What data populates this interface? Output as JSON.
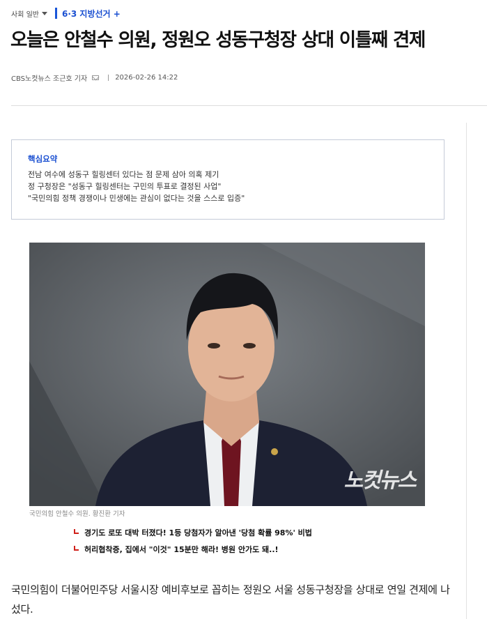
{
  "topbar": {
    "category": "사회 일반",
    "series": "6·3 지방선거 +"
  },
  "article": {
    "headline": "오늘은 안철수 의원, 정원오 성동구청장 상대 이틀째 견제",
    "byline": "CBS노컷뉴스 조근호 기자",
    "date": "2026-02-26 14:22",
    "body": "국민의힘이 더불어민주당 서울시장 예비후보로 꼽히는 정원오 서울 성동구청장을 상대로 연일 견제에 나섰다."
  },
  "summary": {
    "title": "핵심요약",
    "lines": [
      "전남 여수에 성동구 힐링센터 있다는 점 문제 삼아 의혹 제기",
      "정 구청장은 \"성동구 힐링센터는 구민의 투표로 결정된 사업\"",
      "\"국민의힘 정책 경쟁이나 민생에는 관심이 없다는 것을 스스로 입증\""
    ]
  },
  "photo": {
    "watermark": "노컷뉴스",
    "caption": "국민의힘 안철수 의원. 황진환 기자"
  },
  "related": [
    "경기도 로또 대박 터졌다! 1등 당첨자가 알아낸 '당첨 확률 98%' 비법",
    "허리협착증, 집에서 \"이것\" 15분만 해라! 병원 안가도 돼..!"
  ],
  "colors": {
    "accent": "#1a4fd1",
    "bullet": "#d0201a"
  }
}
